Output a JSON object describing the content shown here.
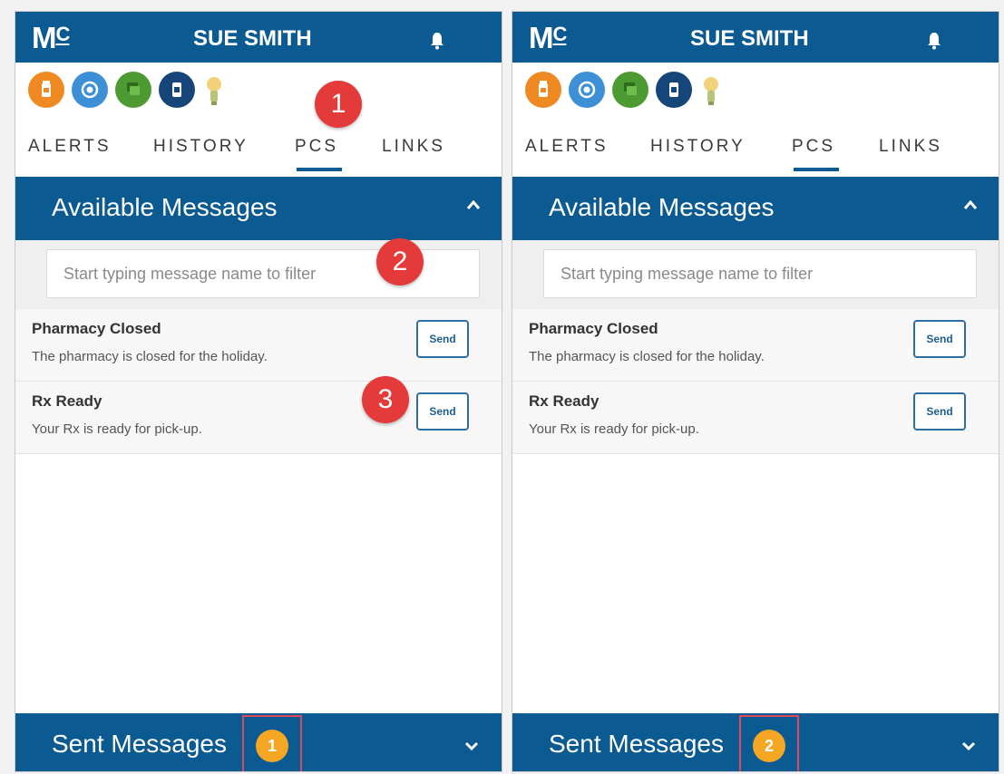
{
  "colors": {
    "brand_blue": "#0b5a92",
    "background": "#ffffff",
    "callout_red": "#e53a3a",
    "badge_orange": "#f5a623",
    "highlight_box": "#e0495d"
  },
  "panels": [
    {
      "header": {
        "logo": "M",
        "logo_sup": "C",
        "user_name": "SUE SMITH",
        "bell_icon": "bell-icon"
      },
      "status_icons": [
        "medication-bottle-icon",
        "settings-icon",
        "chat-icon",
        "prescription-bottle-icon",
        "lightbulb-icon"
      ],
      "tabs": [
        {
          "label": "ALERTS",
          "active": false
        },
        {
          "label": "HISTORY",
          "active": false
        },
        {
          "label": "PCS",
          "active": true
        },
        {
          "label": "LINKS",
          "active": false
        }
      ],
      "available": {
        "title": "Available Messages",
        "filter_placeholder": "Start typing message name to filter",
        "messages": [
          {
            "title": "Pharmacy Closed",
            "description": "The pharmacy is closed for the holiday.",
            "button": "Send"
          },
          {
            "title": "Rx Ready",
            "description": "Your Rx is ready for pick-up.",
            "button": "Send"
          }
        ]
      },
      "sent": {
        "title": "Sent Messages",
        "count": "1"
      },
      "callouts": [
        "1",
        "2",
        "3"
      ]
    },
    {
      "header": {
        "logo": "M",
        "logo_sup": "C",
        "user_name": "SUE SMITH",
        "bell_icon": "bell-icon"
      },
      "status_icons": [
        "medication-bottle-icon",
        "settings-icon",
        "chat-icon",
        "prescription-bottle-icon",
        "lightbulb-icon"
      ],
      "tabs": [
        {
          "label": "ALERTS",
          "active": false
        },
        {
          "label": "HISTORY",
          "active": false
        },
        {
          "label": "PCS",
          "active": true
        },
        {
          "label": "LINKS",
          "active": false
        }
      ],
      "available": {
        "title": "Available Messages",
        "filter_placeholder": "Start typing message name to filter",
        "messages": [
          {
            "title": "Pharmacy Closed",
            "description": "The pharmacy is closed for the holiday.",
            "button": "Send"
          },
          {
            "title": "Rx Ready",
            "description": "Your Rx is ready for pick-up.",
            "button": "Send"
          }
        ]
      },
      "sent": {
        "title": "Sent Messages",
        "count": "2"
      }
    }
  ]
}
